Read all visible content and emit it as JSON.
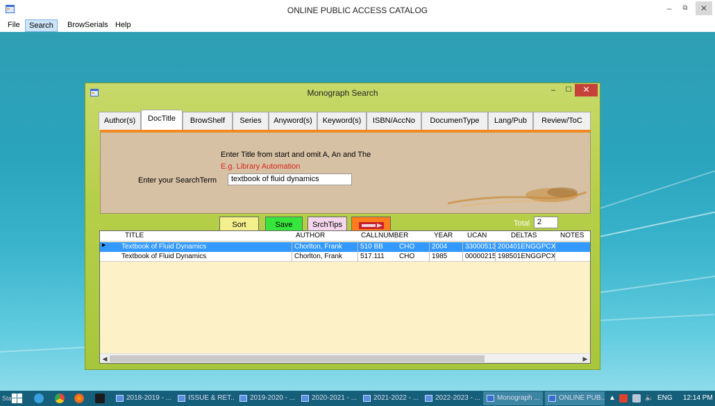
{
  "window": {
    "title": "ONLINE PUBLIC ACCESS CATALOG",
    "controls": {
      "minimize": "–",
      "restore": "⧉",
      "close": "✕"
    }
  },
  "menu": {
    "items": [
      "File",
      "Search",
      "BrowSerials",
      "Help"
    ],
    "active": "Search"
  },
  "dialog": {
    "title": "Monograph Search",
    "tabs": [
      "Author(s)",
      "DocTitle",
      "BrowShelf",
      "Series",
      "Anyword(s)",
      "Keyword(s)",
      "ISBN/AccNo",
      "DocumenType",
      "Lang/Pub",
      "Review/ToC"
    ],
    "active_tab": "DocTitle",
    "instruction": "Enter Title from start and omit  A, An and The",
    "example": "E.g. Library Automation",
    "search_label": "Enter your SearchTerm",
    "search_value": "textbook of fluid dynamics",
    "buttons": {
      "sort": "Sort",
      "save": "Save",
      "tips": "SrchTips"
    },
    "total_label": "Total",
    "total_value": "2",
    "grid": {
      "columns": [
        "TITLE",
        "AUTHOR",
        "CALLNUMBER",
        "YEAR",
        "UCAN",
        "DELTAS",
        "NOTES"
      ],
      "rows": [
        {
          "title": "Textbook of Fluid Dynamics",
          "author": "Chorlton, Frank",
          "callnumber": "510 BB",
          "callsuffix": "CHO",
          "year": "2004",
          "ucan": "33000513",
          "deltas": "200401ENGGPCX",
          "notes": "",
          "selected": true
        },
        {
          "title": "Textbook of Fluid Dynamics",
          "author": "Chorlton, Frank",
          "callnumber": "517.111",
          "callsuffix": "CHO",
          "year": "1985",
          "ucan": "00000215",
          "deltas": "198501ENGGPCX",
          "notes": "",
          "selected": false
        }
      ]
    }
  },
  "taskbar": {
    "status": "Status",
    "items": [
      "2018-2019 - ...",
      "ISSUE & RET...",
      "2019-2020 - ...",
      "2020-2021 - ...",
      "2021-2022 - ...",
      "2022-2023 - ...",
      "Monograph ...",
      "ONLINE PUB..."
    ],
    "active_items": [
      "Monograph ...",
      "ONLINE PUB..."
    ],
    "tray": {
      "language": "ENG",
      "time": "12:14 PM"
    }
  },
  "colors": {
    "desktop": "#2aa3bd",
    "dialog": "#b6cf4a",
    "panel": "#d6c1a5",
    "accent": "#f2891e",
    "selected_row": "#3399ff",
    "close_button": "#c7413b"
  }
}
